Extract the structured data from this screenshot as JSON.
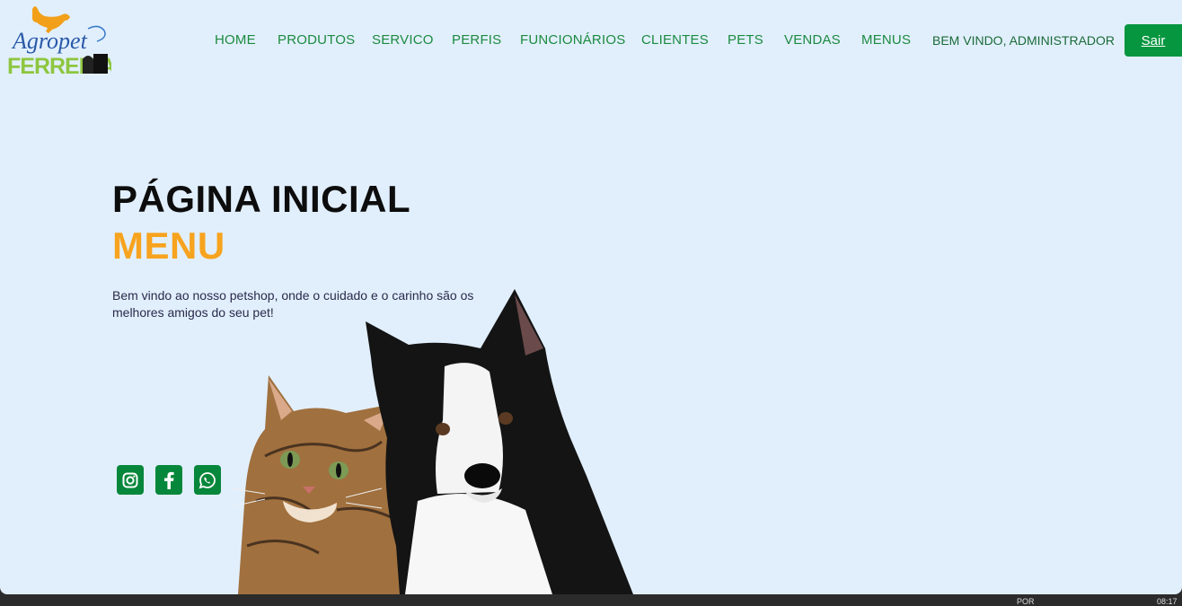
{
  "header": {
    "logo_alt": "Agropet Ferreira",
    "nav": [
      {
        "label": "HOME"
      },
      {
        "label": "PRODUTOS"
      },
      {
        "label": "SERVICO"
      },
      {
        "label": "PERFIS"
      },
      {
        "label": "FUNCIONÁRIOS"
      },
      {
        "label": "CLIENTES"
      },
      {
        "label": "PETS"
      },
      {
        "label": "VENDAS"
      },
      {
        "label": "MENUS"
      }
    ],
    "welcome": "BEM VINDO, ADMINISTRADOR",
    "logout_label": "Sair"
  },
  "hero": {
    "title": "PÁGINA INICIAL",
    "subtitle": "MENU",
    "text": "Bem vindo ao nosso petshop, onde o cuidado e o carinho são os melhores amigos do seu pet!"
  },
  "social": [
    {
      "icon": "instagram-icon"
    },
    {
      "icon": "facebook-icon"
    },
    {
      "icon": "whatsapp-icon"
    }
  ],
  "taskbar": {
    "lang": "POR",
    "time": "08:17"
  },
  "colors": {
    "background": "#e1effd",
    "nav": "#1c8a3f",
    "accent": "#f7a31e",
    "button": "#05963f"
  }
}
